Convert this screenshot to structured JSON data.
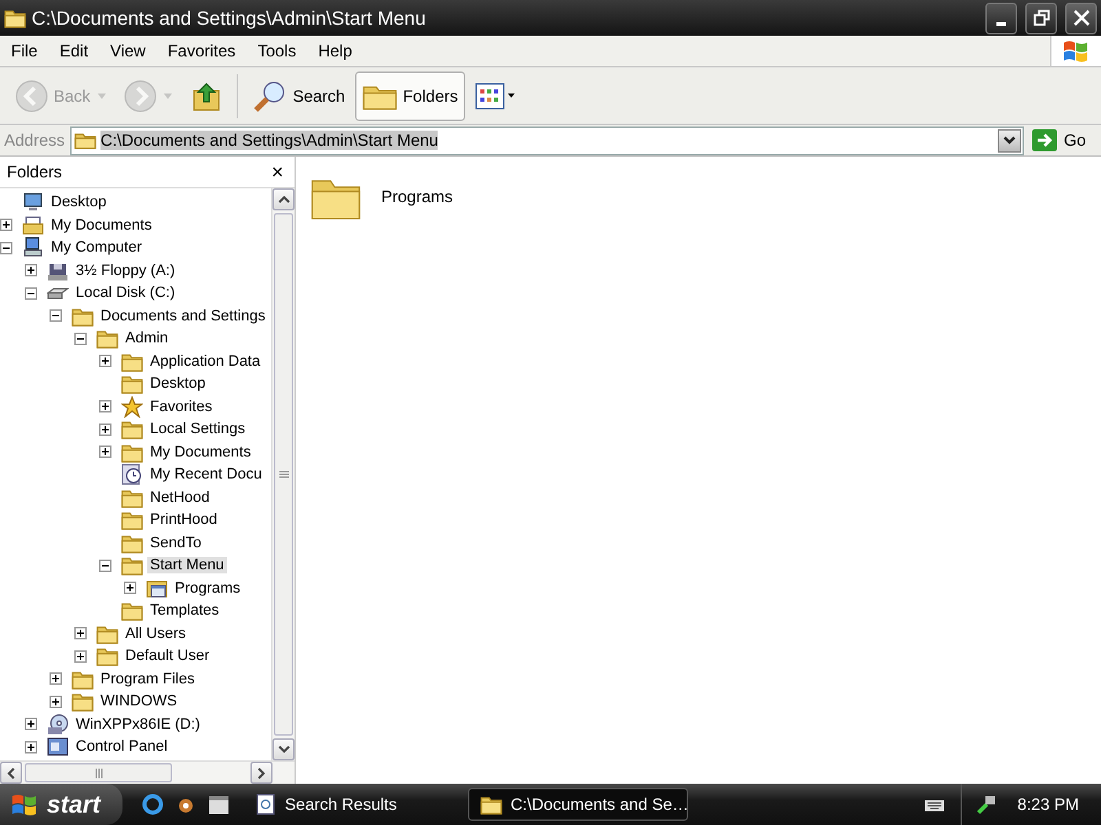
{
  "window": {
    "title": "C:\\Documents and Settings\\Admin\\Start Menu"
  },
  "menu": [
    "File",
    "Edit",
    "View",
    "Favorites",
    "Tools",
    "Help"
  ],
  "toolbar": [
    {
      "kind": "back",
      "label": "Back",
      "disabled": true,
      "pressed": false
    },
    {
      "kind": "forward",
      "disabled": true,
      "pressed": false
    },
    {
      "kind": "up",
      "disabled": false,
      "pressed": false
    },
    {
      "kind": "search",
      "label": "Search",
      "disabled": false,
      "pressed": false
    },
    {
      "kind": "folders",
      "label": "Folders",
      "disabled": false,
      "pressed": true
    },
    {
      "kind": "views",
      "disabled": false,
      "pressed": false
    }
  ],
  "address": {
    "label": "Address",
    "value": "C:\\Documents and Settings\\Admin\\Start Menu",
    "go": "Go"
  },
  "folders_pane": {
    "title": "Folders",
    "close": "×",
    "tree": [
      {
        "label": "Desktop",
        "kind": "desktop",
        "selected": false
      },
      {
        "label": "My Documents",
        "kind": "documents",
        "expanded": false,
        "selected": false
      },
      {
        "label": "My Computer",
        "kind": "computer",
        "expanded": true,
        "selected": false,
        "children": [
          {
            "label": "3½ Floppy (A:)",
            "kind": "floppy",
            "expanded": false,
            "selected": false
          },
          {
            "label": "Local Disk (C:)",
            "kind": "disk",
            "expanded": true,
            "selected": false,
            "children": [
              {
                "label": "Documents and Settings",
                "kind": "folder",
                "expanded": true,
                "selected": false,
                "children": [
                  {
                    "label": "Admin",
                    "kind": "folder",
                    "expanded": true,
                    "selected": false,
                    "children": [
                      {
                        "label": "Application Data",
                        "kind": "folder",
                        "expanded": false,
                        "selected": false
                      },
                      {
                        "label": "Desktop",
                        "kind": "folder",
                        "selected": false
                      },
                      {
                        "label": "Favorites",
                        "kind": "star",
                        "expanded": false,
                        "selected": false
                      },
                      {
                        "label": "Local Settings",
                        "kind": "folder",
                        "expanded": false,
                        "selected": false
                      },
                      {
                        "label": "My Documents",
                        "kind": "folder",
                        "expanded": false,
                        "selected": false
                      },
                      {
                        "label": "My Recent Docu",
                        "kind": "recent",
                        "selected": false
                      },
                      {
                        "label": "NetHood",
                        "kind": "folder",
                        "selected": false
                      },
                      {
                        "label": "PrintHood",
                        "kind": "folder",
                        "selected": false
                      },
                      {
                        "label": "SendTo",
                        "kind": "folder",
                        "selected": false
                      },
                      {
                        "label": "Start Menu",
                        "kind": "folder",
                        "expanded": true,
                        "selected": true,
                        "children": [
                          {
                            "label": "Programs",
                            "kind": "programs",
                            "expanded": false,
                            "selected": false
                          }
                        ]
                      },
                      {
                        "label": "Templates",
                        "kind": "folder",
                        "selected": false
                      }
                    ]
                  },
                  {
                    "label": "All Users",
                    "kind": "folder",
                    "expanded": false,
                    "selected": false
                  },
                  {
                    "label": "Default User",
                    "kind": "folder",
                    "expanded": false,
                    "selected": false
                  }
                ]
              },
              {
                "label": "Program Files",
                "kind": "folder",
                "expanded": false,
                "selected": false
              },
              {
                "label": "WINDOWS",
                "kind": "folder",
                "expanded": false,
                "selected": false
              }
            ]
          },
          {
            "label": "WinXPPx86IE (D:)",
            "kind": "cd",
            "expanded": false,
            "selected": false
          },
          {
            "label": "Control Panel",
            "kind": "control",
            "expanded": false,
            "selected": false
          }
        ]
      }
    ]
  },
  "content": {
    "items": [
      {
        "label": "Programs",
        "kind": "folder",
        "selected": false
      }
    ]
  },
  "taskbar": {
    "start": "start",
    "tasks": [
      {
        "label": "Search Results",
        "kind": "search",
        "selected": false
      },
      {
        "label": "C:\\Documents and Se…",
        "kind": "folder",
        "selected": true
      }
    ],
    "clock": "8:23 PM"
  }
}
